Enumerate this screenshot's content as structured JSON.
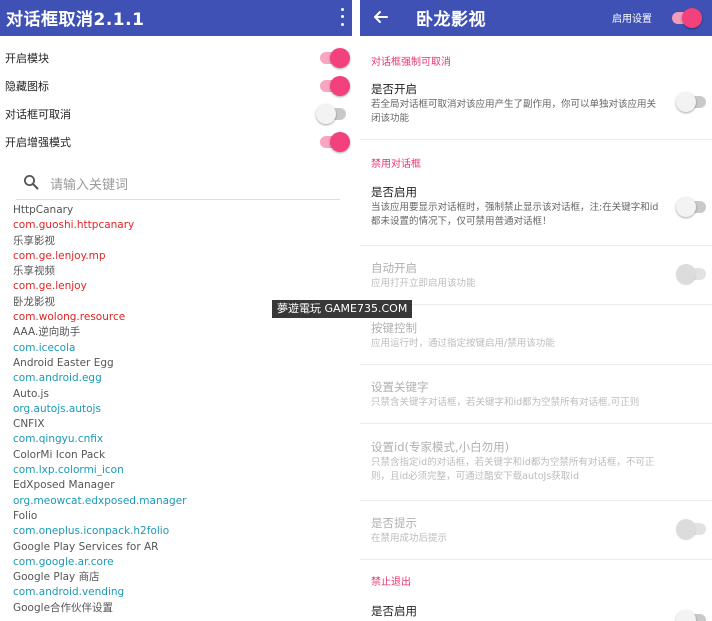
{
  "left": {
    "title": "对话框取消2.1.1",
    "toggles": [
      {
        "label": "开启模块",
        "on": true
      },
      {
        "label": "隐藏图标",
        "on": true
      },
      {
        "label": "对话框可取消",
        "on": false
      },
      {
        "label": "开启增强模式",
        "on": true
      }
    ],
    "search_placeholder": "请输入关键词",
    "apps": [
      {
        "text": "HttpCanary",
        "style": "normal"
      },
      {
        "text": "com.guoshi.httpcanary",
        "style": "red"
      },
      {
        "text": "乐享影视",
        "style": "normal"
      },
      {
        "text": "com.ge.lenjoy.mp",
        "style": "red"
      },
      {
        "text": "乐享视频",
        "style": "normal"
      },
      {
        "text": "com.ge.lenjoy",
        "style": "red"
      },
      {
        "text": "卧龙影视",
        "style": "normal"
      },
      {
        "text": "com.wolong.resource",
        "style": "red"
      },
      {
        "text": "AAA.逆向助手",
        "style": "normal"
      },
      {
        "text": "com.icecola",
        "style": "blue"
      },
      {
        "text": "Android Easter Egg",
        "style": "normal"
      },
      {
        "text": "com.android.egg",
        "style": "blue"
      },
      {
        "text": "Auto.js",
        "style": "normal"
      },
      {
        "text": "org.autojs.autojs",
        "style": "blue"
      },
      {
        "text": "CNFIX",
        "style": "normal"
      },
      {
        "text": "com.qingyu.cnfix",
        "style": "blue"
      },
      {
        "text": "ColorMi Icon Pack",
        "style": "normal"
      },
      {
        "text": "com.lxp.colormi_icon",
        "style": "blue"
      },
      {
        "text": "EdXposed Manager",
        "style": "normal"
      },
      {
        "text": "org.meowcat.edxposed.manager",
        "style": "blue"
      },
      {
        "text": "Folio",
        "style": "normal"
      },
      {
        "text": "com.oneplus.iconpack.h2folio",
        "style": "blue"
      },
      {
        "text": "Google Play Services for AR",
        "style": "normal"
      },
      {
        "text": "com.google.ar.core",
        "style": "blue"
      },
      {
        "text": "Google Play 商店",
        "style": "normal"
      },
      {
        "text": "com.android.vending",
        "style": "blue"
      },
      {
        "text": "Google合作伙伴设置",
        "style": "normal"
      }
    ]
  },
  "right": {
    "title": "卧龙影视",
    "enable_setting_label": "启用设置",
    "enable_setting_on": true,
    "sections": {
      "cancelable": "对话框强制可取消",
      "disable_dialog": "禁用对话框",
      "prohibit_exit": "禁止退出"
    },
    "prefs": {
      "enable": {
        "title": "是否开启",
        "summary": "若全局对话框可取消对该应用产生了副作用，你可以单独对该应用关闭该功能",
        "on": false
      },
      "disable_enable": {
        "title": "是否启用",
        "summary": "当该应用要显示对话框时，强制禁止显示该对话框，注:在关键字和id都未设置的情况下，仅可禁用普通对话框！",
        "on": false
      },
      "auto_enable": {
        "title": "自动开启",
        "summary": "应用打开立即启用该功能",
        "on": false
      },
      "key_control": {
        "title": "按键控制",
        "summary": "应用运行时，通过指定按键启用/禁用该功能"
      },
      "set_keyword": {
        "title": "设置关键字",
        "summary": "只禁含关键字对话框，若关键字和id都为空禁所有对话框,可正则"
      },
      "set_id": {
        "title": "设置id(专家模式,小白勿用)",
        "summary": "只禁含指定id的对话框，若关键字和id都为空禁所有对话框，不可正则，且id必须完整，可通过酷安下载autoJs获取id"
      },
      "show_hint": {
        "title": "是否提示",
        "summary": "在禁用成功后提示",
        "on": false
      },
      "exit_enable": {
        "title": "是否启用",
        "on": false
      }
    }
  },
  "watermark": "夢遊電玩 GAME735.COM",
  "colors": {
    "appbar": "#3f51b5",
    "accent": "#e8356f",
    "switch_on_knob": "#f2417c",
    "package_red": "#e02424",
    "package_blue": "#1a99b8"
  },
  "icons": [
    "overflow-menu-icon",
    "search-icon",
    "back-arrow-icon"
  ]
}
